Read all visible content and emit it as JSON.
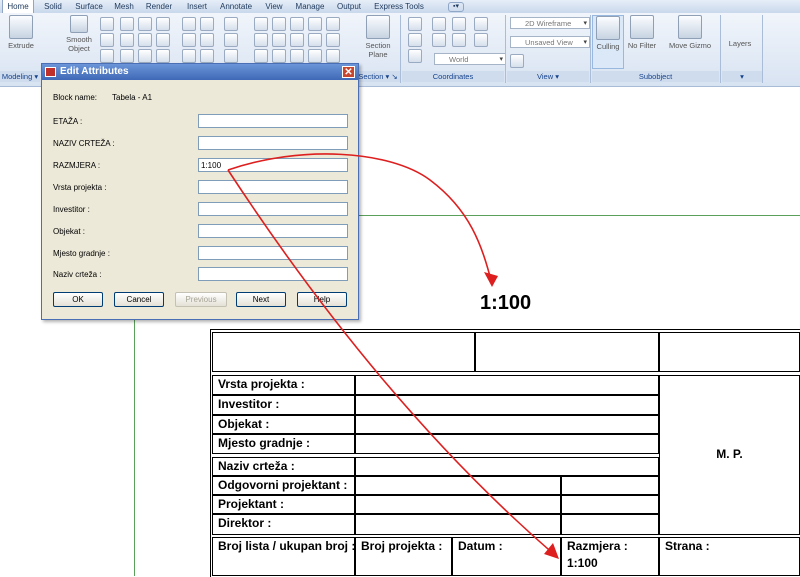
{
  "ribbon": {
    "tabs": [
      "Home",
      "Solid",
      "Surface",
      "Mesh",
      "Render",
      "Insert",
      "Annotate",
      "View",
      "Manage",
      "Output",
      "Express Tools"
    ],
    "active_tab": "Home",
    "buttons": {
      "extrude": "Extrude",
      "smooth_object": "Smooth Object",
      "section_plane": "Section Plane",
      "culling": "Culling",
      "no_filter": "No Filter",
      "move_gizmo": "Move Gizmo",
      "layers": "Layers"
    },
    "combos": {
      "visual_style": "2D Wireframe",
      "view": "Unsaved View",
      "ucs": "World"
    },
    "panels": {
      "modeling": "Modeling",
      "section": "Section",
      "coordinates": "Coordinates",
      "view": "View",
      "subobject": "Subobject"
    }
  },
  "drawing": {
    "scale_text": "1:100",
    "title_block": {
      "vrsta_projekta": "Vrsta projekta :",
      "investitor": "Investitor :",
      "objekat": "Objekat :",
      "mjesto_gradnje": "Mjesto gradnje :",
      "naziv_crteza": "Naziv crteža :",
      "odgovorni_projektant": "Odgovorni projektant :",
      "projektant": "Projektant :",
      "direktor": "Direktor :",
      "mp": "M. P.",
      "broj_lista": "Broj lista / ukupan broj :",
      "broj_projekta": "Broj projekta :",
      "datum": "Datum :",
      "razmjera": "Razmjera :",
      "razmjera_value": "1:100",
      "strana": "Strana :"
    }
  },
  "dialog": {
    "title": "Edit Attributes",
    "block_name_label": "Block name:",
    "block_name_value": "Tabela - A1",
    "fields": [
      {
        "label": "ETAŽA :",
        "value": ""
      },
      {
        "label": "NAZIV CRTEŽA :",
        "value": ""
      },
      {
        "label": "RAZMJERA :",
        "value": "1:100"
      },
      {
        "label": "Vrsta projekta :",
        "value": ""
      },
      {
        "label": "Investitor :",
        "value": ""
      },
      {
        "label": "Objekat :",
        "value": ""
      },
      {
        "label": "Mjesto gradnje :",
        "value": ""
      },
      {
        "label": "Naziv crteža :",
        "value": ""
      }
    ],
    "buttons": {
      "ok": "OK",
      "cancel": "Cancel",
      "previous": "Previous",
      "next": "Next",
      "help": "Help"
    }
  },
  "colors": {
    "annotation_arrow": "#dd1f1f",
    "dialog_title": "#3f69b6",
    "guide_lines": "#5aa05a"
  }
}
